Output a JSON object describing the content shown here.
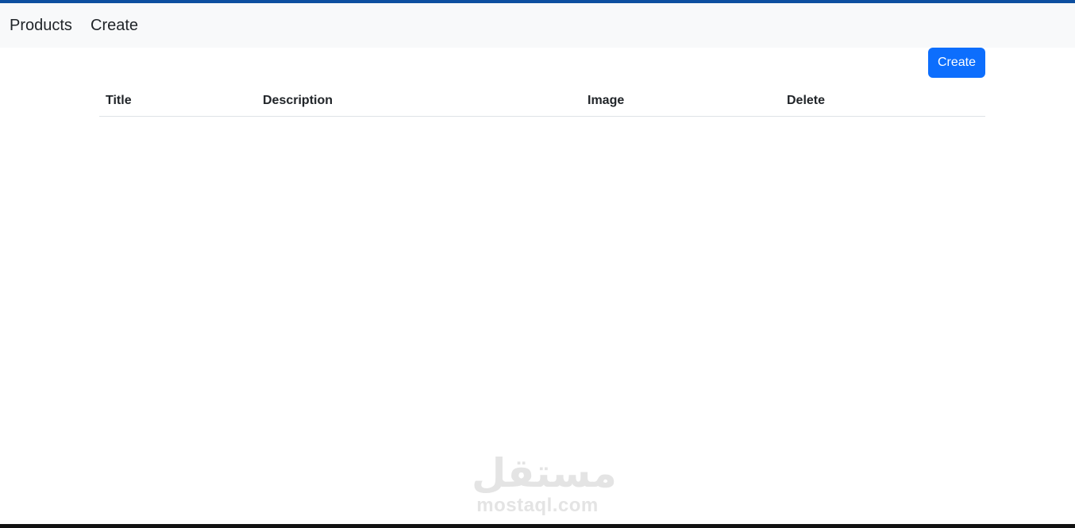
{
  "navbar": {
    "links": [
      {
        "label": "Products"
      },
      {
        "label": "Create"
      }
    ]
  },
  "toolbar": {
    "create_label": "Create"
  },
  "table": {
    "columns": [
      "Title",
      "Description",
      "Image",
      "Delete"
    ],
    "rows": []
  },
  "watermark": {
    "arabic": "مستقل",
    "latin": "mostaql.com"
  },
  "colors": {
    "accent": "#0d6efd",
    "top_bar": "#0d4fa0",
    "navbar_bg": "#f8f9fa"
  }
}
